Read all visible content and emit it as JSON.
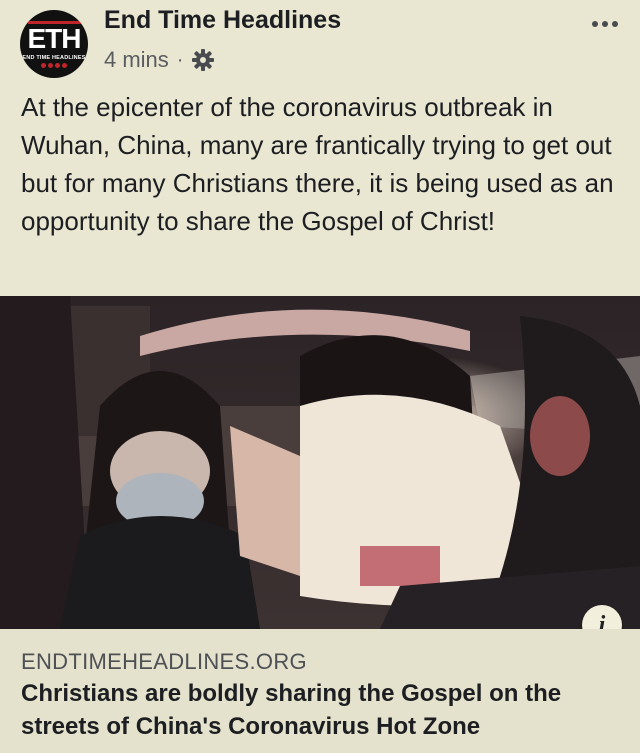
{
  "post": {
    "page_name": "End Time Headlines",
    "timestamp": "4 mins",
    "separator": "·",
    "privacy_icon": "gear-icon",
    "menu_icon": "more-horizontal-icon",
    "avatar": {
      "initials": "ETH",
      "subtitle": "END TIME HEADLINES",
      "accent": "#c0252a"
    },
    "text": "At the epicenter of the coronavirus outbreak in Wuhan, China, many are frantically trying to get out but for many Christians there, it is being used as an opportunity to share the Gospel of Christ!"
  },
  "media": {
    "info_label": "i"
  },
  "link_preview": {
    "domain": "ENDTIMEHEADLINES.ORG",
    "title": "Christians are boldly sharing the Gospel on the streets of China's Coronavirus Hot Zone"
  },
  "colors": {
    "background": "#e9e7d2",
    "link_background": "#e4e2cc",
    "text": "#1c1e21",
    "secondary_text": "#5a5c60"
  }
}
